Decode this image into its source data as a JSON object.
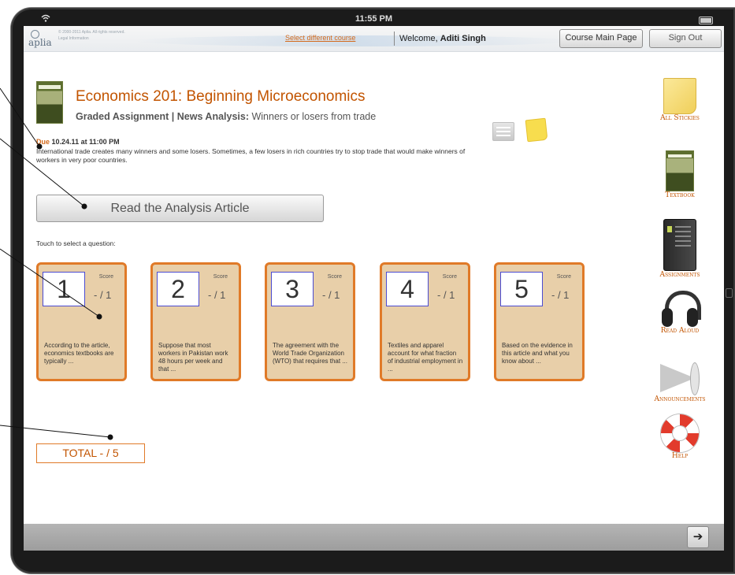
{
  "status_bar": {
    "time": "11:55 PM"
  },
  "header": {
    "logo_text": "aplia",
    "copyright_line1": "© 2000-2011 Aplia. All rights reserved.",
    "copyright_line2": "Legal Information",
    "select_course_link": "Select different course",
    "welcome_prefix": "Welcome,",
    "user_name": "Aditi Singh",
    "course_main_page_button": "Course Main Page",
    "sign_out_button": "Sign Out"
  },
  "course": {
    "title": "Economics 201: Beginning Microeconomics",
    "assignment_prefix": "Graded Assignment | News Analysis:",
    "assignment_title": "Winners or losers from trade",
    "due_label": "Due",
    "due_date": "10.24.11 at 11:00 PM",
    "intro_text": "International trade creates many winners and some losers. Sometimes, a few losers in rich countries try to stop trade that would make winners of workers in very poor countries."
  },
  "read_article_button": "Read the Analysis Article",
  "touch_prompt": "Touch to select a question:",
  "questions": [
    {
      "number": "1",
      "score_label": "Score",
      "score": "- / 1",
      "text": "According to the article, economics textbooks are typically ..."
    },
    {
      "number": "2",
      "score_label": "Score",
      "score": "- / 1",
      "text": "Suppose that most workers in Pakistan work 48 hours per week and that ..."
    },
    {
      "number": "3",
      "score_label": "Score",
      "score": "- / 1",
      "text": "The agreement with the World Trade Organization (WTO) that requires that ..."
    },
    {
      "number": "4",
      "score_label": "Score",
      "score": "- / 1",
      "text": "Textiles and apparel account for what fraction of industrial employment in ..."
    },
    {
      "number": "5",
      "score_label": "Score",
      "score": "- / 1",
      "text": "Based on the evidence in this article and what you know about ..."
    }
  ],
  "total": "TOTAL  - / 5",
  "sidebar": {
    "all_stickies": "All Stickies",
    "textbook": "Textbook",
    "assignments": "Assignments",
    "read_aloud": "Read Aloud",
    "announcements": "Announcements",
    "help": "Help"
  },
  "footer": {
    "next_icon": "arrow-right-icon"
  },
  "colors": {
    "accent": "#c25400",
    "card_fill": "#e8cfa9",
    "card_border": "#e07a28",
    "number_box_border": "#4b4bd1"
  }
}
